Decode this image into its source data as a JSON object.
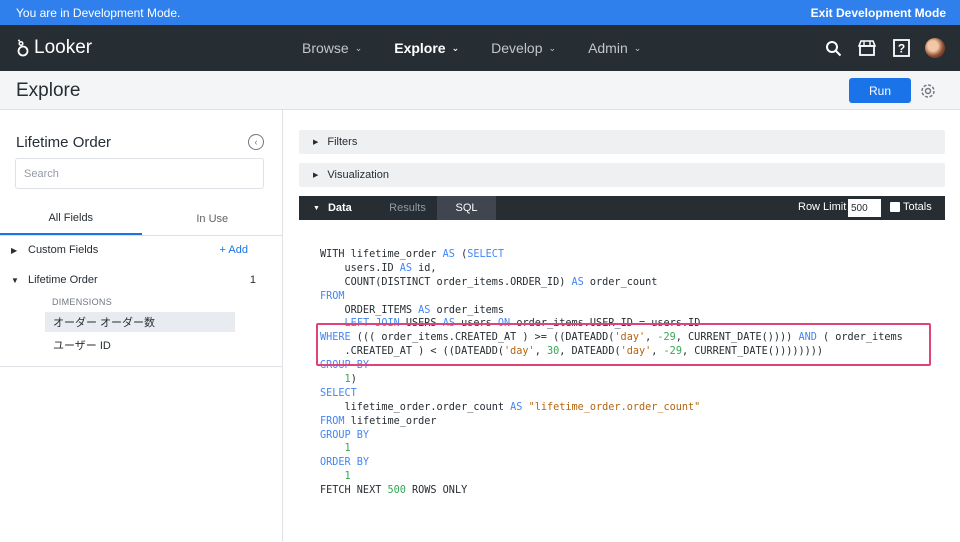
{
  "dev_bar": {
    "message": "You are in Development Mode.",
    "exit_label": "Exit Development Mode",
    "background": "#2f80ed"
  },
  "top_nav": {
    "logo_text": "Looker",
    "items": [
      {
        "label": "Browse",
        "active": false
      },
      {
        "label": "Explore",
        "active": true
      },
      {
        "label": "Develop",
        "active": false
      },
      {
        "label": "Admin",
        "active": false
      }
    ],
    "icons": [
      "search-icon",
      "marketplace-icon",
      "help-icon",
      "user-avatar"
    ],
    "background": "#262d33"
  },
  "header": {
    "title": "Explore",
    "run_label": "Run",
    "settings_icon": "gear-icon"
  },
  "sidebar": {
    "title": "Lifetime Order",
    "search_placeholder": "Search",
    "tabs": [
      {
        "label": "All Fields",
        "active": true
      },
      {
        "label": "In Use",
        "active": false
      }
    ],
    "custom_fields": {
      "label": "Custom Fields",
      "add_label": "+ Add"
    },
    "view": {
      "label": "Lifetime Order",
      "count": "1"
    },
    "dimensions_label": "DIMENSIONS",
    "fields": [
      {
        "label": "オーダー オーダー数",
        "selected": true
      },
      {
        "label": "ユーザー ID",
        "selected": false
      }
    ]
  },
  "main": {
    "filters_label": "Filters",
    "visualization_label": "Visualization",
    "data_bar": {
      "data_label": "Data",
      "tabs": [
        {
          "label": "Results",
          "active": false
        },
        {
          "label": "SQL",
          "active": true
        }
      ],
      "row_limit_label": "Row Limit",
      "row_limit_value": "500",
      "totals_label": "Totals",
      "totals_checked": false
    }
  },
  "sql_lines": [
    [
      [
        "WITH lifetime_order ",
        "t"
      ],
      [
        "AS",
        "k"
      ],
      [
        " (",
        "t"
      ],
      [
        "SELECT",
        "k"
      ]
    ],
    [
      [
        "    users.ID ",
        "t"
      ],
      [
        "AS",
        "k"
      ],
      [
        " id,",
        "t"
      ]
    ],
    [
      [
        "    COUNT(DISTINCT order_items.ORDER_ID) ",
        "t"
      ],
      [
        "AS",
        "k"
      ],
      [
        " order_count",
        "t"
      ]
    ],
    [
      [
        "FROM",
        "k"
      ]
    ],
    [
      [
        "    ORDER_ITEMS ",
        "t"
      ],
      [
        "AS",
        "k"
      ],
      [
        " order_items",
        "t"
      ]
    ],
    [
      [
        "    ",
        "t"
      ],
      [
        "LEFT JOIN",
        "k"
      ],
      [
        " USERS ",
        "t"
      ],
      [
        "AS",
        "k"
      ],
      [
        " users ",
        "t"
      ],
      [
        "ON",
        "k"
      ],
      [
        " order_items.USER_ID = users.ID",
        "t"
      ]
    ],
    [
      [
        "WHERE",
        "k"
      ],
      [
        " ((( order_items.CREATED_AT ) >= ((DATEADD(",
        "t"
      ],
      [
        "'day'",
        "s"
      ],
      [
        ", ",
        "t"
      ],
      [
        "-29",
        "n"
      ],
      [
        ", CURRENT_DATE()))) ",
        "t"
      ],
      [
        "AND",
        "k"
      ],
      [
        " ( order_items",
        "t"
      ]
    ],
    [
      [
        "    .CREATED_AT ) < ((DATEADD(",
        "t"
      ],
      [
        "'day'",
        "s"
      ],
      [
        ", ",
        "t"
      ],
      [
        "30",
        "n"
      ],
      [
        ", DATEADD(",
        "t"
      ],
      [
        "'day'",
        "s"
      ],
      [
        ", ",
        "t"
      ],
      [
        "-29",
        "n"
      ],
      [
        ", CURRENT_DATE())))))))",
        "t"
      ]
    ],
    [
      [
        "GROUP BY",
        "k"
      ]
    ],
    [
      [
        "    ",
        "t"
      ],
      [
        "1",
        "n"
      ],
      [
        ")",
        "t"
      ]
    ],
    [
      [
        "SELECT",
        "k"
      ]
    ],
    [
      [
        "    lifetime_order.order_count ",
        "t"
      ],
      [
        "AS",
        "k"
      ],
      [
        " ",
        "t"
      ],
      [
        "\"lifetime_order.order_count\"",
        "s"
      ]
    ],
    [
      [
        "FROM",
        "k"
      ],
      [
        " lifetime_order",
        "t"
      ]
    ],
    [
      [
        "GROUP BY",
        "k"
      ]
    ],
    [
      [
        "    ",
        "t"
      ],
      [
        "1",
        "n"
      ]
    ],
    [
      [
        "ORDER BY",
        "k"
      ]
    ],
    [
      [
        "    ",
        "t"
      ],
      [
        "1",
        "n"
      ]
    ],
    [
      [
        "FETCH NEXT ",
        "t"
      ],
      [
        "500",
        "n"
      ],
      [
        " ROWS ONLY",
        "t"
      ]
    ]
  ],
  "highlight_color": "#e0427a"
}
